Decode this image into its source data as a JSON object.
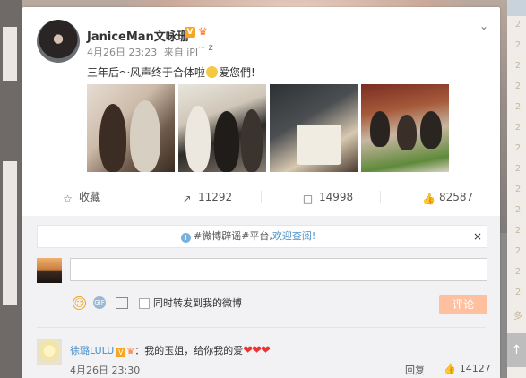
{
  "post": {
    "username": "JaniceMan文咏珊",
    "verified_badge": "V",
    "timestamp": "4月26日 23:23",
    "source": "来自 iPI",
    "text_before_emoji": "三年后～风声终于合体啦",
    "text_after_emoji": "爱您們!",
    "photos": [
      "photo-1",
      "photo-2",
      "photo-3",
      "photo-4"
    ]
  },
  "actions": {
    "favorite": {
      "label": "收藏",
      "icon": "star-icon"
    },
    "repost": {
      "count": "11292",
      "icon": "repost-icon"
    },
    "comment": {
      "count": "14998",
      "icon": "comment-icon"
    },
    "like": {
      "count": "82587",
      "icon": "thumbs-up-icon"
    }
  },
  "notice": {
    "prefix": "#微博辟谣#平台,",
    "link": "欢迎查阅!",
    "close": "×"
  },
  "composer": {
    "repost_label": "同时转发到我的微博",
    "submit_label": "评论",
    "gif_label": "GIF"
  },
  "comments": [
    {
      "author": "徐璐LULU",
      "text": "：我的玉姐，给你我的爱",
      "hearts": "❤❤❤",
      "time": "4月26日 23:30",
      "reply_label": "回复",
      "likes": "14127"
    }
  ],
  "right_rail": [
    "2",
    "2",
    "2",
    "2",
    "2",
    "2",
    "2",
    "2",
    "2",
    "2",
    "2",
    "2",
    "2",
    "2",
    "多"
  ],
  "colors": {
    "link_blue": "#4a90c8",
    "submit_bg": "#ffc09f",
    "heart": "#e33333",
    "badge": "#f5a623"
  }
}
